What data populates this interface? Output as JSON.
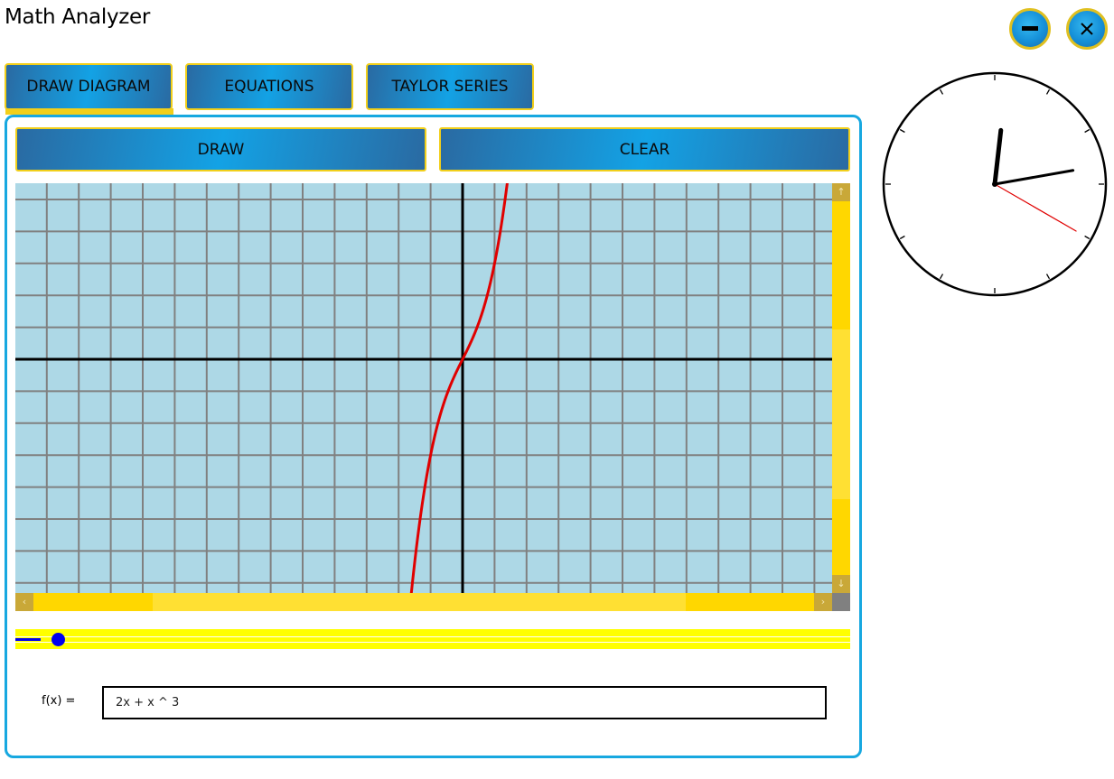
{
  "app": {
    "title": "Math Analyzer"
  },
  "window_controls": {
    "minimize_icon": "minus-icon",
    "close_icon": "close-x-icon"
  },
  "tabs": [
    {
      "label": "DRAW DIAGRAM",
      "selected": true
    },
    {
      "label": "EQUATIONS",
      "selected": false
    },
    {
      "label": "TAYLOR SERIES",
      "selected": false
    }
  ],
  "toolbar": {
    "draw_label": "DRAW",
    "clear_label": "CLEAR"
  },
  "graph": {
    "function": "2x + x ^ 3",
    "curve_color": "#e00000",
    "background_color": "#add8e6",
    "grid_color": "#808080",
    "axis_color": "#000000",
    "scroll_up_icon": "arrow-up-icon",
    "scroll_down_icon": "arrow-down-icon",
    "scroll_left_icon": "arrow-left-icon",
    "scroll_right_icon": "arrow-right-icon"
  },
  "zoom_slider": {
    "value_fraction": 0.03
  },
  "formula": {
    "label": "f(x) =",
    "value": "2x + x ^ 3"
  },
  "colors": {
    "accent_blue": "#17a8e0",
    "accent_gold": "#f2cf1a",
    "scrollbar_yellow": "#ffd700",
    "slider_blue": "#0000ee"
  },
  "clock": {
    "hours": 12,
    "minutes": 13,
    "seconds": 20
  }
}
